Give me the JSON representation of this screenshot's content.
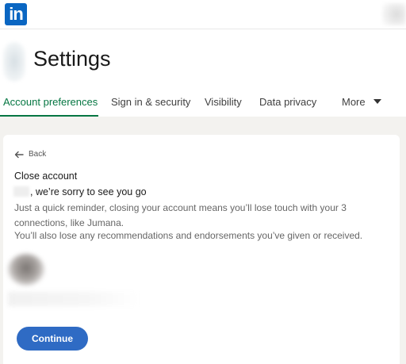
{
  "topbar": {
    "logo_text": "in",
    "logo_color": "#0a66c2"
  },
  "header": {
    "title": "Settings"
  },
  "tabs": [
    {
      "label": "Account preferences",
      "active": true
    },
    {
      "label": "Sign in & security",
      "active": false
    },
    {
      "label": "Visibility",
      "active": false
    },
    {
      "label": "Data privacy",
      "active": false
    },
    {
      "label": "More",
      "active": false
    }
  ],
  "card": {
    "back_label": "Back",
    "title": "Close account",
    "sorry_text": ", we’re sorry to see you go",
    "reminder_text": "Just a quick reminder, closing your account means you’ll lose touch with your 3 connections, like Jumana.",
    "also_text": "You’ll also lose any recommendations and endorsements you’ve given or received.",
    "continue_label": "Continue"
  },
  "colors": {
    "accent_green": "#057642",
    "button_blue": "#2f6bc4",
    "page_background": "#f3f2ef"
  },
  "icons": {
    "back": "arrow-left-icon",
    "more": "caret-down-icon"
  }
}
